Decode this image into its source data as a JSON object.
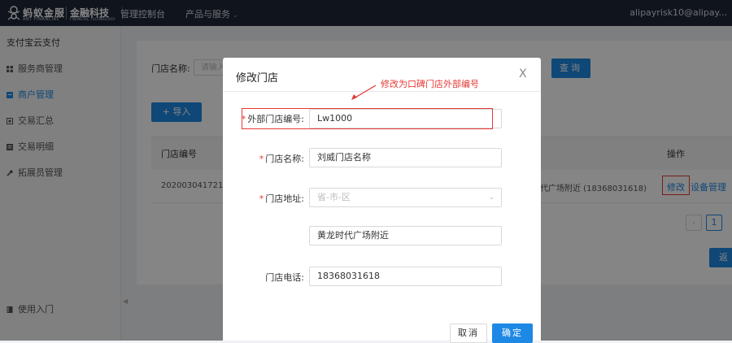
{
  "topbar": {
    "logo_cn": "蚂蚁金服",
    "logo_en": "ANT FINANCIAL",
    "logo_fin": "金融科技",
    "logo_fin_en": "FINANCIAL TECHNOLOGY",
    "console": "管理控制台",
    "products": "产品与服务",
    "user": "alipayrisk10@alipay..."
  },
  "sidebar": {
    "title": "支付宝云支付",
    "items": [
      {
        "label": "服务商管理",
        "icon": "grid-icon"
      },
      {
        "label": "商户管理",
        "icon": "store-icon"
      },
      {
        "label": "交易汇总",
        "icon": "summary-icon"
      },
      {
        "label": "交易明细",
        "icon": "detail-icon"
      },
      {
        "label": "拓展员管理",
        "icon": "wrench-icon"
      }
    ],
    "bottom_item": "使用入门"
  },
  "main": {
    "filter_label": "门店名称:",
    "filter_placeholder": "请输入",
    "query_button": "查询",
    "import_button": "+ 导入",
    "table": {
      "col_store": "门店编号",
      "col_op": "操作",
      "row": {
        "store_id": "2020030417210",
        "address": "代广场附近 (18368031618)",
        "edit": "修改",
        "device": "设备管理"
      }
    },
    "pagination": {
      "prev": "‹",
      "current": "1"
    },
    "back_button": "返"
  },
  "modal": {
    "title": "修改门店",
    "close": "X",
    "annotation": "修改为口碑门店外部编号",
    "fields": {
      "external_id_label": "外部门店编号:",
      "external_id_value": "Lw1000",
      "name_label": "门店名称:",
      "name_value": "刘威门店名称",
      "address_label": "门店地址:",
      "address_placeholder": "省-市-区",
      "address_detail": "黄龙时代广场附近",
      "phone_label": "门店电话:",
      "phone_value": "18368031618"
    },
    "cancel_button": "取消",
    "ok_button": "确定",
    "required_mark": "*"
  },
  "colors": {
    "primary": "#1e88e5",
    "annotation": "#e53935",
    "topbar": "#1f2739"
  }
}
